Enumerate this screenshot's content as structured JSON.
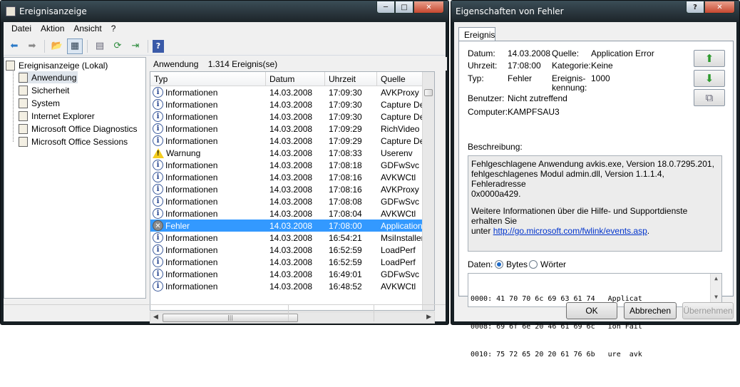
{
  "main_window": {
    "title": "Ereignisanzeige",
    "menu": [
      "Datei",
      "Aktion",
      "Ansicht",
      "?"
    ],
    "tree_root": "Ereignisanzeige (Lokal)",
    "tree_items": [
      "Anwendung",
      "Sicherheit",
      "System",
      "Internet Explorer",
      "Microsoft Office Diagnostics",
      "Microsoft Office Sessions"
    ],
    "panel_name": "Anwendung",
    "panel_count": "1.314 Ereignis(se)",
    "columns": [
      "Typ",
      "Datum",
      "Uhrzeit",
      "Quelle"
    ],
    "rows": [
      {
        "type": "Informationen",
        "icon": "info",
        "date": "14.03.2008",
        "time": "17:09:30",
        "source": "AVKProxy"
      },
      {
        "type": "Informationen",
        "icon": "info",
        "date": "14.03.2008",
        "time": "17:09:30",
        "source": "Capture Devic"
      },
      {
        "type": "Informationen",
        "icon": "info",
        "date": "14.03.2008",
        "time": "17:09:30",
        "source": "Capture Devic"
      },
      {
        "type": "Informationen",
        "icon": "info",
        "date": "14.03.2008",
        "time": "17:09:29",
        "source": "RichVideo"
      },
      {
        "type": "Informationen",
        "icon": "info",
        "date": "14.03.2008",
        "time": "17:09:29",
        "source": "Capture Devic"
      },
      {
        "type": "Warnung",
        "icon": "warning",
        "date": "14.03.2008",
        "time": "17:08:33",
        "source": "Userenv"
      },
      {
        "type": "Informationen",
        "icon": "info",
        "date": "14.03.2008",
        "time": "17:08:18",
        "source": "GDFwSvc"
      },
      {
        "type": "Informationen",
        "icon": "info",
        "date": "14.03.2008",
        "time": "17:08:16",
        "source": "AVKWCtl"
      },
      {
        "type": "Informationen",
        "icon": "info",
        "date": "14.03.2008",
        "time": "17:08:16",
        "source": "AVKProxy"
      },
      {
        "type": "Informationen",
        "icon": "info",
        "date": "14.03.2008",
        "time": "17:08:08",
        "source": "GDFwSvc"
      },
      {
        "type": "Informationen",
        "icon": "info",
        "date": "14.03.2008",
        "time": "17:08:04",
        "source": "AVKWCtl"
      },
      {
        "type": "Fehler",
        "icon": "error",
        "date": "14.03.2008",
        "time": "17:08:00",
        "source": "Application Er",
        "selected": true
      },
      {
        "type": "Informationen",
        "icon": "info",
        "date": "14.03.2008",
        "time": "16:54:21",
        "source": "MsiInstaller"
      },
      {
        "type": "Informationen",
        "icon": "info",
        "date": "14.03.2008",
        "time": "16:52:59",
        "source": "LoadPerf"
      },
      {
        "type": "Informationen",
        "icon": "info",
        "date": "14.03.2008",
        "time": "16:52:59",
        "source": "LoadPerf"
      },
      {
        "type": "Informationen",
        "icon": "info",
        "date": "14.03.2008",
        "time": "16:49:01",
        "source": "GDFwSvc"
      },
      {
        "type": "Informationen",
        "icon": "info",
        "date": "14.03.2008",
        "time": "16:48:52",
        "source": "AVKWCtl"
      }
    ]
  },
  "props": {
    "title": "Eigenschaften von Fehler",
    "tab": "Ereignis",
    "datum_label": "Datum:",
    "datum": "14.03.2008",
    "quelle_label": "Quelle:",
    "quelle": "Application Error",
    "uhrzeit_label": "Uhrzeit:",
    "uhrzeit": "17:08:00",
    "kategorie_label": "Kategorie:",
    "kategorie": "Keine",
    "typ_label": "Typ:",
    "typ": "Fehler",
    "kennung_label1": "Ereignis-",
    "kennung_label2": "kennung:",
    "kennung": "1000",
    "benutzer_label": "Benutzer:",
    "benutzer": "Nicht zutreffend",
    "computer_label": "Computer:",
    "computer": "KAMPFSAU3",
    "beschreibung_label": "Beschreibung:",
    "desc_line1": "Fehlgeschlagene Anwendung avkis.exe, Version 18.0.7295.201,",
    "desc_line2": "fehlgeschlagenes Modul admin.dll, Version 1.1.1.4, Fehleradresse",
    "desc_line3": "0x0000a429.",
    "desc_line4": "Weitere Informationen über die Hilfe- und Supportdienste erhalten Sie",
    "desc_pre_link": "unter ",
    "desc_link": "http://go.microsoft.com/fwlink/events.asp",
    "desc_post_link": ".",
    "daten_label": "Daten:",
    "radio_bytes": "Bytes",
    "radio_words": "Wörter",
    "hex_lines": [
      "0000: 41 70 70 6c 69 63 61 74   Applicat",
      "0008: 69 6f 6e 20 46 61 69 6c   ion Fail",
      "0010: 75 72 65 20 20 61 76 6b   ure  avk"
    ],
    "ok": "OK",
    "cancel": "Abbrechen",
    "apply": "Übernehmen"
  }
}
